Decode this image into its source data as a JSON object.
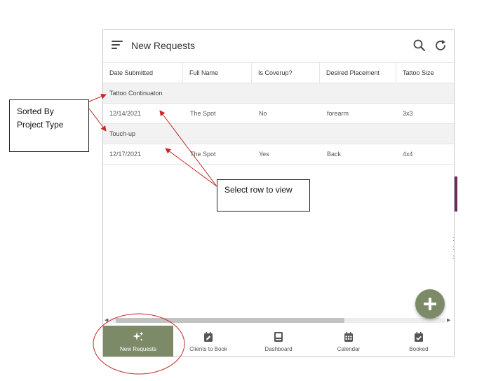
{
  "app": {
    "title": "New Requests",
    "header_icons": [
      "menu-icon",
      "search-icon",
      "refresh-icon"
    ]
  },
  "table": {
    "columns": [
      "Date Submitted",
      "Full Name",
      "Is Coverup?",
      "Desired Placement",
      "Tattoo Size"
    ],
    "groups": [
      {
        "label": "Tattoo Continuaton",
        "rows": [
          {
            "date": "12/14/2021",
            "name": "The Spot",
            "coverup": "No",
            "placement": "forearm",
            "size": "3x3"
          }
        ]
      },
      {
        "label": "Touch-up",
        "rows": [
          {
            "date": "12/17/2021",
            "name": "The Spot",
            "coverup": "Yes",
            "placement": "Back",
            "size": "4x4"
          }
        ]
      }
    ]
  },
  "fab": {
    "icon": "plus-icon"
  },
  "bottom_nav": [
    {
      "label": "New Requests",
      "icon": "sparkles-icon",
      "active": true
    },
    {
      "label": "Clients to Book",
      "icon": "calendar-edit-icon",
      "active": false
    },
    {
      "label": "Dashboard",
      "icon": "book-icon",
      "active": false
    },
    {
      "label": "Calendar",
      "icon": "calendar-grid-icon",
      "active": false
    },
    {
      "label": "Booked",
      "icon": "calendar-check-icon",
      "active": false
    }
  ],
  "annotations": {
    "sorted_note_line1": "Sorted By",
    "sorted_note_line2": "Project Type",
    "select_note": "Select row to view"
  },
  "colors": {
    "accent": "#7c8a68",
    "group_row_bg": "#f2f2f2",
    "annotation_arrow": "#c62828"
  }
}
